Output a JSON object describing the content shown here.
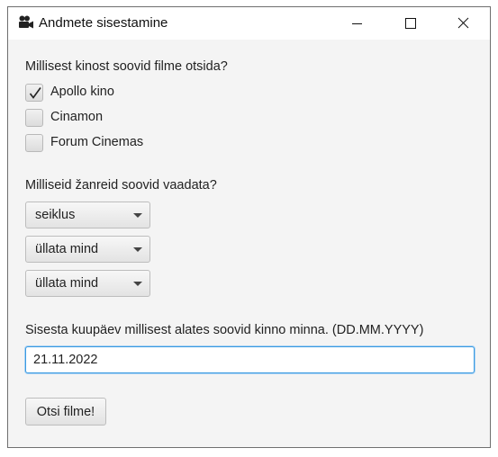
{
  "window": {
    "title": "Andmete sisestamine",
    "icon": "movie-camera-icon"
  },
  "cinema_section": {
    "question": "Millisest kinost soovid filme otsida?",
    "options": [
      {
        "label": "Apollo kino",
        "checked": true
      },
      {
        "label": "Cinamon",
        "checked": false
      },
      {
        "label": "Forum Cinemas",
        "checked": false
      }
    ]
  },
  "genre_section": {
    "question": "Milliseid žanreid soovid vaadata?",
    "selects": [
      {
        "value": "seiklus"
      },
      {
        "value": "üllata mind"
      },
      {
        "value": "üllata mind"
      }
    ]
  },
  "date_section": {
    "question": "Sisesta kuupäev millisest alates soovid kinno minna. (DD.MM.YYYY)",
    "value": "21.11.2022"
  },
  "search_button": {
    "label": "Otsi filme!"
  }
}
